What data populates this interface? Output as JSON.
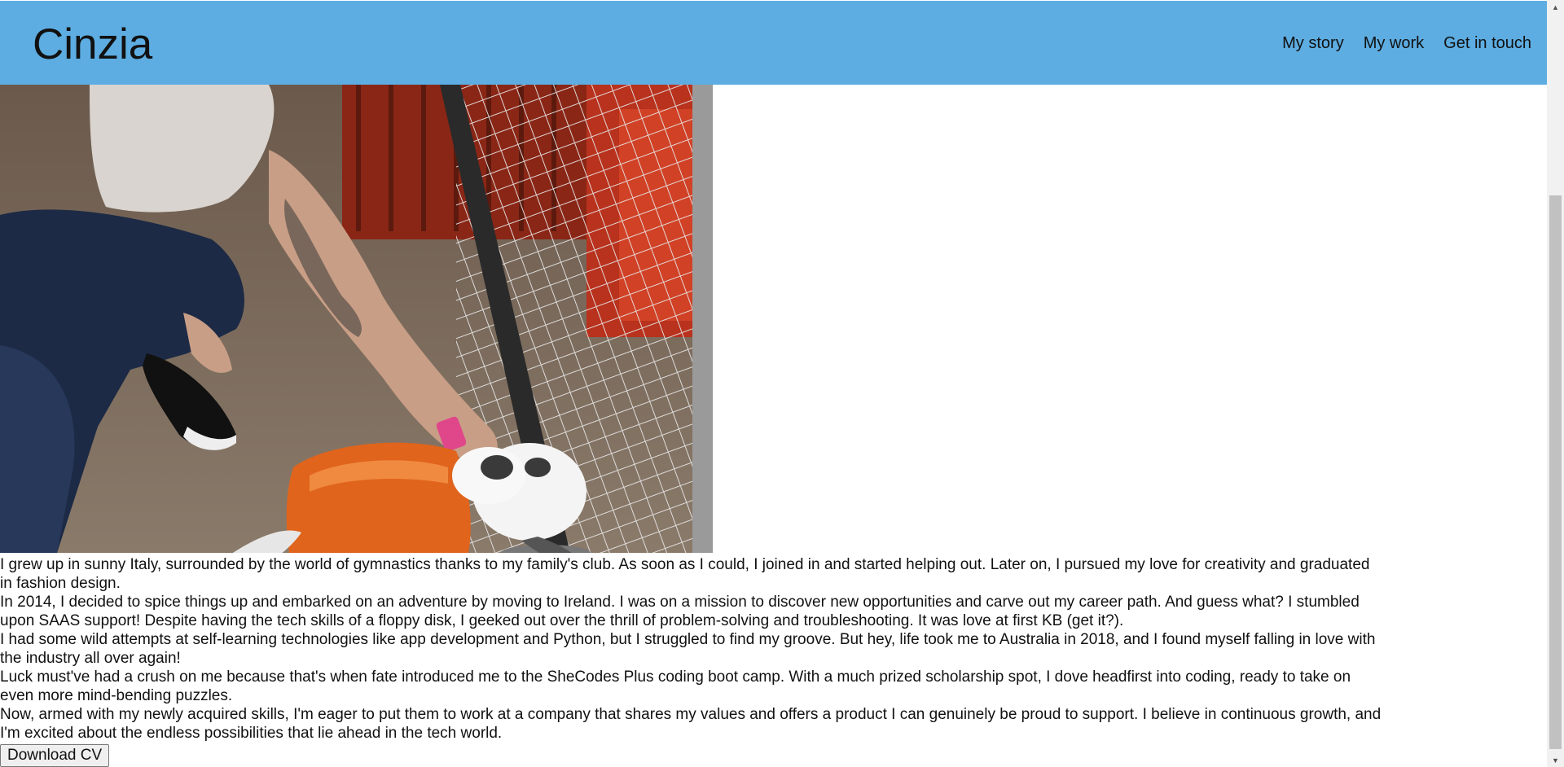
{
  "header": {
    "brand": "Cinzia",
    "nav": [
      "My story",
      "My work",
      "Get in touch"
    ]
  },
  "bio": [
    "I grew up in sunny Italy, surrounded by the world of gymnastics thanks to my family's club. As soon as I could, I joined in and started helping out. Later on, I pursued my love for creativity and graduated in fashion design.",
    "In 2014, I decided to spice things up and embarked on an adventure by moving to Ireland. I was on a mission to discover new opportunities and carve out my career path. And guess what? I stumbled upon SAAS support! Despite having the tech skills of a floppy disk, I geeked out over the thrill of problem-solving and troubleshooting. It was love at first KB (get it?).",
    "I had some wild attempts at self-learning technologies like app development and Python, but I struggled to find my groove. But hey, life took me to Australia in 2018, and I found myself falling in love with the industry all over again!",
    "Luck must've had a crush on me because that's when fate introduced me to the SheCodes Plus coding boot camp. With a much prized scholarship spot, I dove headfirst into coding, ready to take on even more mind-bending puzzles.",
    "Now, armed with my newly acquired skills, I'm eager to put them to work at a company that shares my values and offers a product I can genuinely be proud to support. I believe in continuous growth, and I'm excited about the endless possibilities that lie ahead in the tech world."
  ],
  "download_label": "Download CV",
  "colors": {
    "header_bg": "#5dade2"
  },
  "icons": {
    "scroll_up": "▲",
    "scroll_down": "▼"
  }
}
